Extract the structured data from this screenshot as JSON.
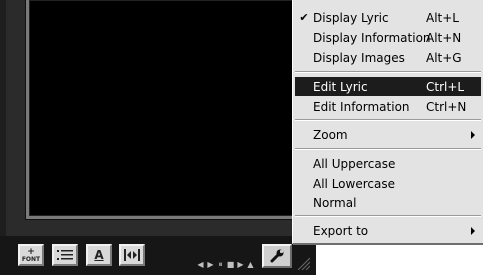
{
  "toolbar": {
    "font_label": "FONT",
    "text_style_glyph": "A"
  },
  "transport_glyphs": [
    "◀",
    "▶",
    "⏸",
    "■",
    "▶",
    "▲"
  ],
  "menu": {
    "items": [
      {
        "label": "Display Lyric",
        "accel": "Alt+L",
        "checked": true
      },
      {
        "label": "Display Information",
        "accel": "Alt+N"
      },
      {
        "label": "Display Images",
        "accel": "Alt+G"
      },
      {
        "label": "Edit Lyric",
        "accel": "Ctrl+L",
        "selected": true
      },
      {
        "label": "Edit Information",
        "accel": "Ctrl+N"
      },
      {
        "label": "Zoom",
        "submenu": true
      },
      {
        "label": "All Uppercase"
      },
      {
        "label": "All Lowercase"
      },
      {
        "label": "Normal"
      },
      {
        "label": "Export to",
        "submenu": true
      }
    ],
    "check_glyph": "✔"
  },
  "colors": {
    "menu_bg": "#e3e3e3",
    "selected_bg": "#1c1c1c",
    "lyric_bg": "#000000"
  }
}
